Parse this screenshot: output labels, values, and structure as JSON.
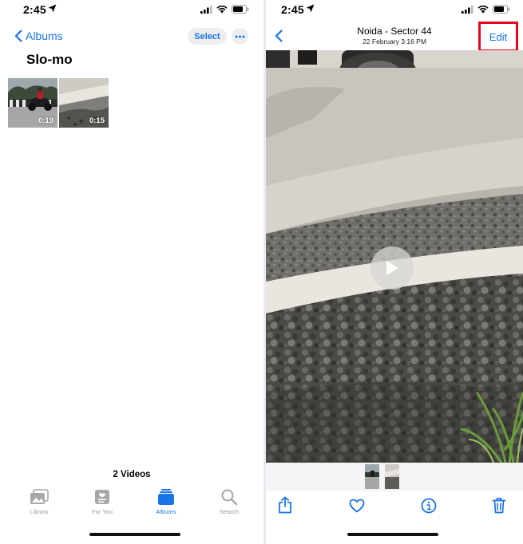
{
  "left": {
    "status": {
      "time": "2:45"
    },
    "nav": {
      "back_label": "Albums",
      "select_label": "Select"
    },
    "title": "Slo-mo",
    "videos": [
      {
        "duration": "0:19"
      },
      {
        "duration": "0:15"
      }
    ],
    "count_label": "2 Videos",
    "tabs": [
      {
        "label": "Library",
        "icon": "photo-library-icon"
      },
      {
        "label": "For You",
        "icon": "for-you-icon"
      },
      {
        "label": "Albums",
        "icon": "albums-icon",
        "active": true
      },
      {
        "label": "Search",
        "icon": "search-icon"
      }
    ]
  },
  "right": {
    "status": {
      "time": "2:45"
    },
    "header": {
      "title": "Noida - Sector 44",
      "subtitle": "22 February  3:16 PM",
      "edit_label": "Edit"
    },
    "toolbar": [
      "share-icon",
      "heart-icon",
      "info-icon",
      "trash-icon"
    ]
  },
  "colors": {
    "accent": "#1a73e8",
    "highlight": "#e3071c"
  }
}
